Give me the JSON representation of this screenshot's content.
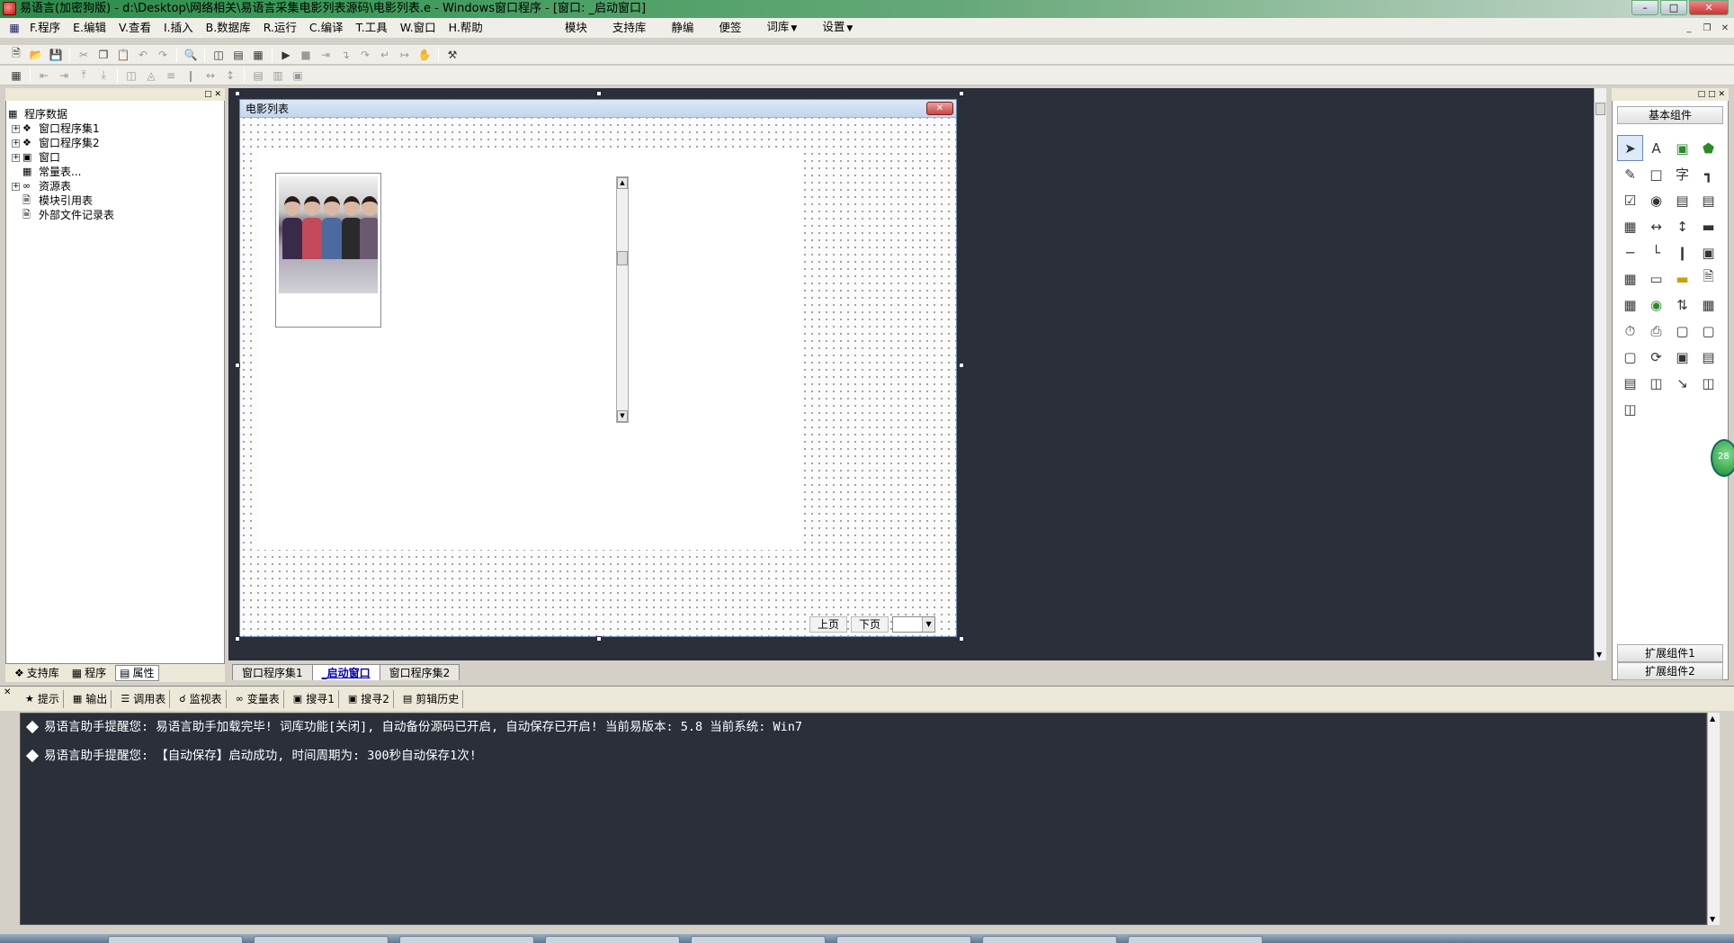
{
  "window": {
    "title": "易语言(加密狗版) - d:\\Desktop\\网络相关\\易语言采集电影列表源码\\电影列表.e - Windows窗口程序 - [窗口: _启动窗口]"
  },
  "menu": [
    {
      "label": "F.程序"
    },
    {
      "label": "E.编辑"
    },
    {
      "label": "V.查看"
    },
    {
      "label": "I.插入"
    },
    {
      "label": "B.数据库"
    },
    {
      "label": "R.运行"
    },
    {
      "label": "C.编译"
    },
    {
      "label": "T.工具"
    },
    {
      "label": "W.窗口"
    },
    {
      "label": "H.帮助"
    }
  ],
  "menu_ext": [
    {
      "label": "模块"
    },
    {
      "label": "支持库"
    },
    {
      "label": "静编"
    },
    {
      "label": "便签"
    },
    {
      "label": "词库"
    },
    {
      "label": "设置"
    }
  ],
  "tree": {
    "root": "程序数据",
    "items": [
      {
        "label": "窗口程序集1"
      },
      {
        "label": "窗口程序集2"
      },
      {
        "label": "窗口"
      },
      {
        "label": "常量表..."
      },
      {
        "label": "资源表"
      },
      {
        "label": "模块引用表"
      },
      {
        "label": "外部文件记录表"
      }
    ]
  },
  "left_tabs": [
    {
      "label": "支持库"
    },
    {
      "label": "程序"
    },
    {
      "label": "属性"
    }
  ],
  "form": {
    "title": "电影列表",
    "prev_button": "上页",
    "next_button": "下页"
  },
  "doc_tabs": [
    {
      "label": "窗口程序集1"
    },
    {
      "label": "_启动窗口"
    },
    {
      "label": "窗口程序集2"
    }
  ],
  "right_panel": {
    "header": "基本组件",
    "ext1": "扩展组件1",
    "ext2": "扩展组件2",
    "badge": "28"
  },
  "output_tabs": [
    {
      "label": "提示"
    },
    {
      "label": "输出"
    },
    {
      "label": "调用表"
    },
    {
      "label": "监视表"
    },
    {
      "label": "变量表"
    },
    {
      "label": "搜寻1"
    },
    {
      "label": "搜寻2"
    },
    {
      "label": "剪辑历史"
    }
  ],
  "output_lines": [
    "易语言助手提醒您:  易语言助手加载完毕! 词库功能[关闭], 自动备份源码已开启, 自动保存已开启! 当前易版本: 5.8  当前系统: Win7",
    "易语言助手提醒您: 【自动保存】启动成功, 时间周期为: 300秒自动保存1次!"
  ]
}
